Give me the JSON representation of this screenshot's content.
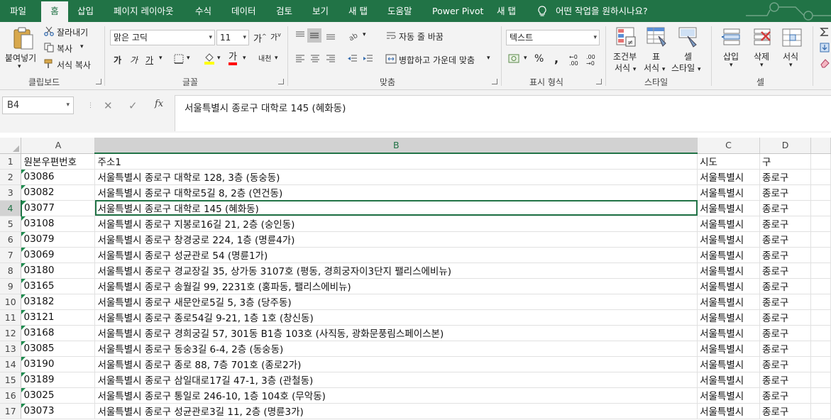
{
  "tabs": [
    {
      "label": "파일",
      "active": false
    },
    {
      "label": "홈",
      "active": true
    },
    {
      "label": "삽입",
      "active": false
    },
    {
      "label": "페이지 레이아웃",
      "active": false
    },
    {
      "label": "수식",
      "active": false
    },
    {
      "label": "데이터",
      "active": false
    },
    {
      "label": "검토",
      "active": false
    },
    {
      "label": "보기",
      "active": false
    },
    {
      "label": "새 탭",
      "active": false
    },
    {
      "label": "도움말",
      "active": false
    },
    {
      "label": "Power Pivot",
      "active": false
    },
    {
      "label": "새 탭",
      "active": false
    }
  ],
  "tell_me": "어떤 작업을 원하시나요?",
  "ribbon": {
    "clipboard": {
      "paste": "붙여넣기",
      "cut": "잘라내기",
      "copy": "복사",
      "format_painter": "서식 복사",
      "group_label": "클립보드"
    },
    "font": {
      "font_name": "맑은 고딕",
      "font_size": "11",
      "grow": "가",
      "shrink": "가",
      "bold": "가",
      "italic": "가",
      "underline": "가",
      "font_color_glyph": "가",
      "phonetic": "내천",
      "group_label": "글꼴"
    },
    "alignment": {
      "wrap_text": "자동 줄 바꿈",
      "merge_center": "병합하고 가운데 맞춤",
      "group_label": "맞춤"
    },
    "number": {
      "format": "텍스트",
      "percent": "%",
      "comma": ",",
      "inc_decimal": "←0 .00",
      "dec_decimal": ".00 →0",
      "group_label": "표시 형식"
    },
    "styles": {
      "conditional_1": "조건부",
      "conditional_2": "서식",
      "table_1": "표",
      "table_2": "서식",
      "cell_styles_1": "셀",
      "cell_styles_2": "스타일",
      "group_label": "스타일"
    },
    "cells": {
      "insert": "삽입",
      "delete": "삭제",
      "format": "서식",
      "group_label": "셀"
    }
  },
  "formula_bar": {
    "name_box": "B4",
    "cancel": "✕",
    "enter": "✓",
    "fx": "fx",
    "content": "서울특별시 종로구 대학로 145 (혜화동)"
  },
  "sheet": {
    "columns": [
      "A",
      "B",
      "C",
      "D"
    ],
    "selected_column": "B",
    "selected_row": 4,
    "rows": [
      {
        "n": "1",
        "a": "원본우편번호",
        "b": "주소1",
        "c": "시도",
        "d": "구"
      },
      {
        "n": "2",
        "a": "03086",
        "b": "서울특별시 종로구 대학로 128, 3층 (동숭동)",
        "c": "서울특별시",
        "d": "종로구"
      },
      {
        "n": "3",
        "a": "03082",
        "b": "서울특별시 종로구 대학로5길 8, 2층 (연건동)",
        "c": "서울특별시",
        "d": "종로구"
      },
      {
        "n": "4",
        "a": "03077",
        "b": "서울특별시 종로구 대학로 145 (혜화동)",
        "c": "서울특별시",
        "d": "종로구"
      },
      {
        "n": "5",
        "a": "03108",
        "b": "서울특별시 종로구 지봉로16길 21, 2층 (숭인동)",
        "c": "서울특별시",
        "d": "종로구"
      },
      {
        "n": "6",
        "a": "03079",
        "b": "서울특별시 종로구 창경궁로 224, 1층 (명륜4가)",
        "c": "서울특별시",
        "d": "종로구"
      },
      {
        "n": "7",
        "a": "03069",
        "b": "서울특별시 종로구 성균관로 54 (명륜1가)",
        "c": "서울특별시",
        "d": "종로구"
      },
      {
        "n": "8",
        "a": "03180",
        "b": "서울특별시 종로구 경교장길 35, 상가동 3107호 (평동, 경희궁자이3단지 팰리스에비뉴)",
        "c": "서울특별시",
        "d": "종로구"
      },
      {
        "n": "9",
        "a": "03165",
        "b": "서울특별시 종로구 송월길 99, 2231호 (홍파동, 팰리스에비뉴)",
        "c": "서울특별시",
        "d": "종로구"
      },
      {
        "n": "10",
        "a": "03182",
        "b": "서울특별시 종로구 새문안로5길 5, 3층 (당주동)",
        "c": "서울특별시",
        "d": "종로구"
      },
      {
        "n": "11",
        "a": "03121",
        "b": "서울특별시 종로구 종로54길 9-21, 1층 1호 (창신동)",
        "c": "서울특별시",
        "d": "종로구"
      },
      {
        "n": "12",
        "a": "03168",
        "b": "서울특별시 종로구 경희궁길 57, 301동 B1층 103호 (사직동, 광화문풍림스페이스본)",
        "c": "서울특별시",
        "d": "종로구"
      },
      {
        "n": "13",
        "a": "03085",
        "b": "서울특별시 종로구 동숭3길 6-4, 2층 (동숭동)",
        "c": "서울특별시",
        "d": "종로구"
      },
      {
        "n": "14",
        "a": "03190",
        "b": "서울특별시 종로구 종로 88, 7층 701호 (종로2가)",
        "c": "서울특별시",
        "d": "종로구"
      },
      {
        "n": "15",
        "a": "03189",
        "b": "서울특별시 종로구 삼일대로17길 47-1, 3층 (관철동)",
        "c": "서울특별시",
        "d": "종로구"
      },
      {
        "n": "16",
        "a": "03025",
        "b": "서울특별시 종로구 통일로 246-10, 1층 104호 (무악동)",
        "c": "서울특별시",
        "d": "종로구"
      },
      {
        "n": "17",
        "a": "03073",
        "b": "서울특별시 종로구 성균관로3길 11, 2층 (명륜3가)",
        "c": "서울특별시",
        "d": "종로구"
      }
    ]
  },
  "colors": {
    "accent": "#217346",
    "ribbon_bg": "#f3f3f3",
    "error_triangle": "#1e8c4e"
  }
}
